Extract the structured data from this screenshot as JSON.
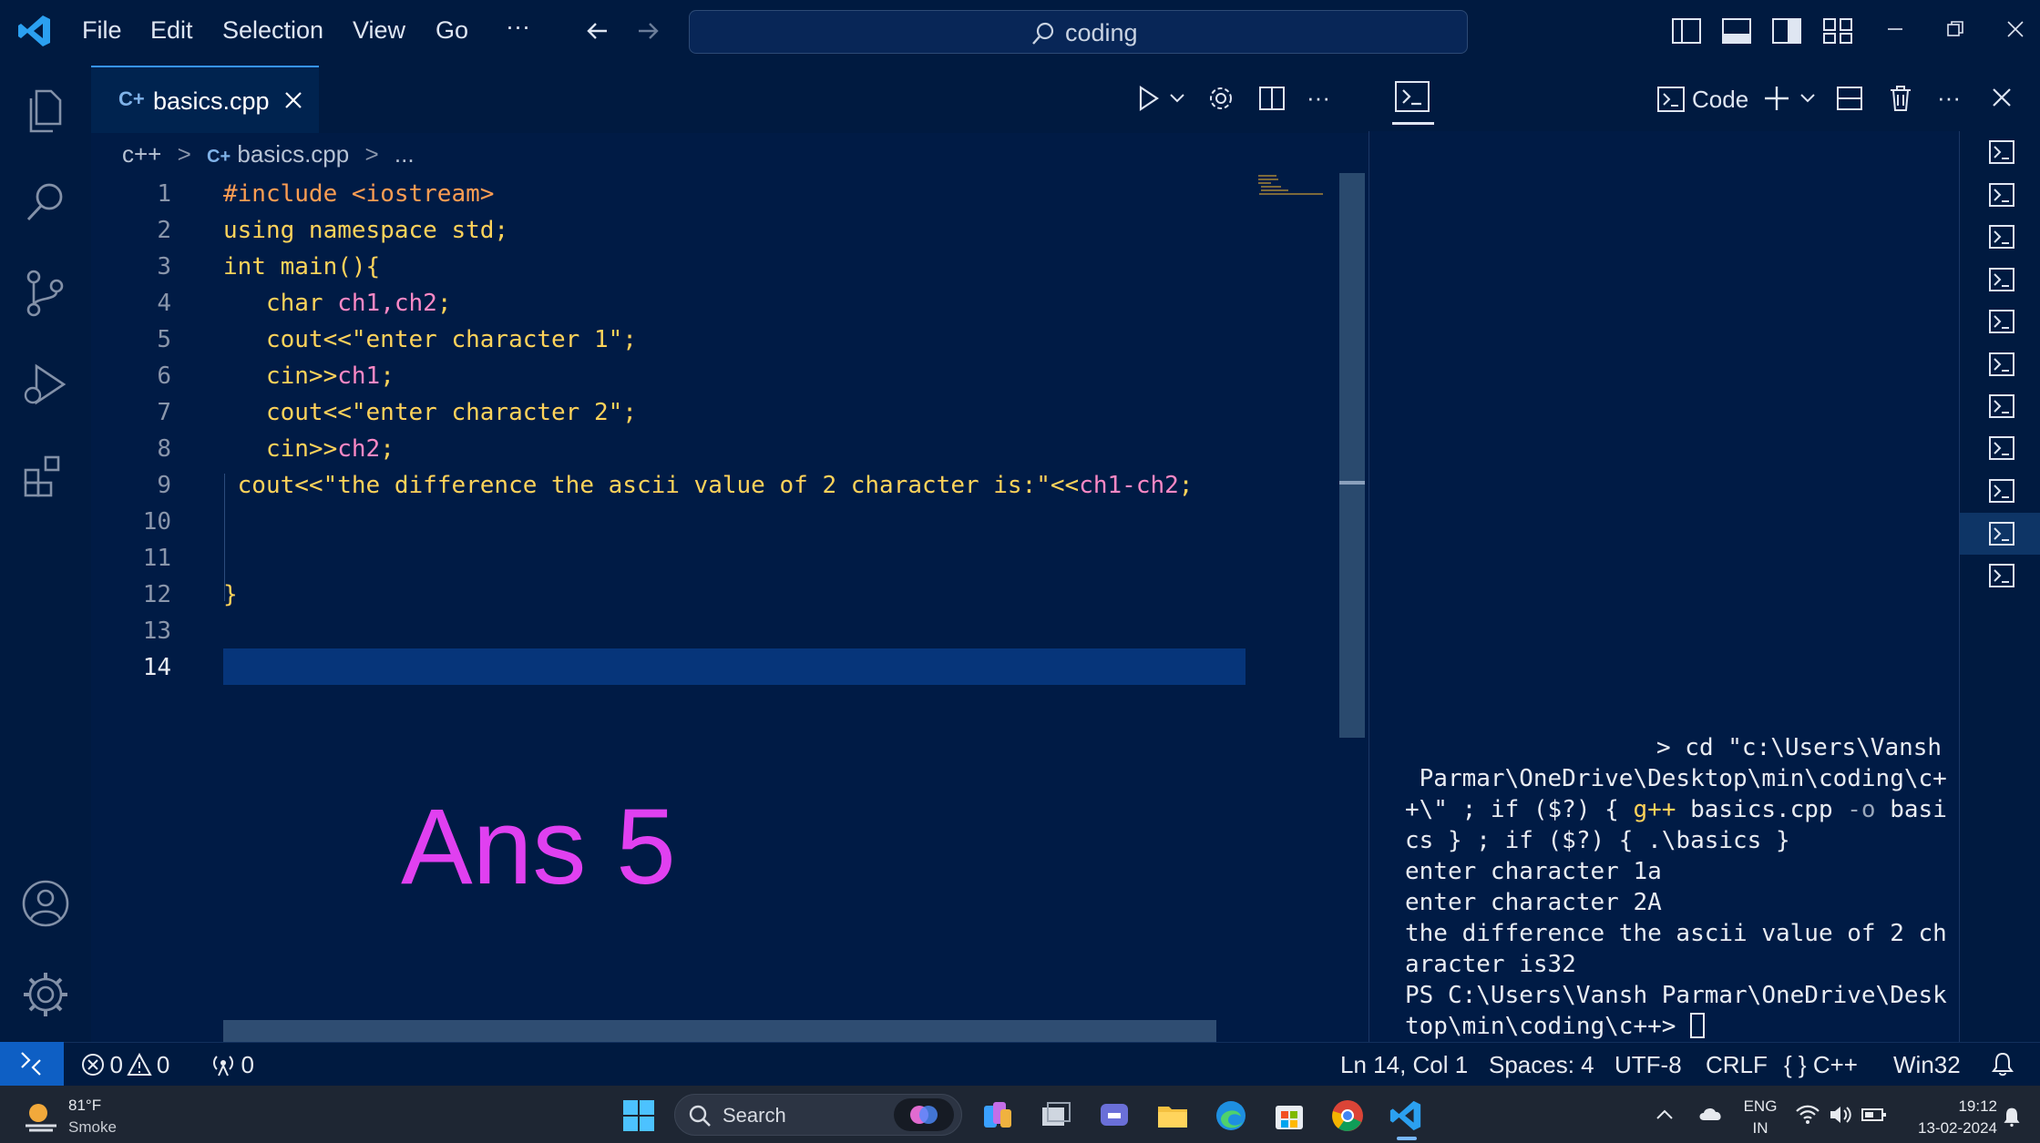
{
  "menu": {
    "file": "File",
    "edit": "Edit",
    "selection": "Selection",
    "view": "View",
    "go": "Go",
    "more": "···"
  },
  "search": {
    "text": "coding"
  },
  "editor": {
    "tab_label": "basics.cpp",
    "breadcrumb": {
      "folder": "c++",
      "file": "basics.cpp",
      "ellipsis": "..."
    },
    "line_numbers": [
      "1",
      "2",
      "3",
      "4",
      "5",
      "6",
      "7",
      "8",
      "9",
      "10",
      "11",
      "12",
      "13",
      "14"
    ],
    "code": {
      "l1_a": "#include",
      "l1_b": " <iostream>",
      "l2_a": "using namespace",
      "l2_b": " std;",
      "l3_a": "int",
      "l3_b": " main(){",
      "l4_a": "   char",
      "l4_b": " ch1,",
      "l4_c": "ch2",
      "l4_d": ";",
      "l5": "   cout<<\"enter character 1\";",
      "l6_a": "   cin>>",
      "l6_b": "ch1",
      "l6_c": ";",
      "l7": "   cout<<\"enter character 2\";",
      "l8_a": "   cin>>",
      "l8_b": "ch2",
      "l8_c": ";",
      "l9_a": " cout<<\"the difference the ascii value of 2 character is:\"<<",
      "l9_b": "ch1-ch2",
      "l9_c": ";",
      "l12": "}"
    },
    "overlay_text": "Ans 5"
  },
  "panel": {
    "code_label": "Code",
    "terminal_lines": [
      "> cd \"c:\\Users\\Vansh",
      " Parmar\\OneDrive\\Desktop\\min\\coding\\c+",
      "+\\\" ; if ($?) { g++ basics.cpp -o basi",
      "cs } ; if ($?) { .\\basics }",
      "enter character 1a",
      "enter character 2A",
      "the difference the ascii value of 2 ch",
      "aracter is32",
      "PS C:\\Users\\Vansh Parmar\\OneDrive\\Desk",
      "top\\min\\coding\\c++> "
    ],
    "t3_a": "+\\\" ; if ($?) { ",
    "t3_b": "g++",
    "t3_c": " basics.cpp ",
    "t3_d": "-o",
    "t3_e": " basi"
  },
  "status": {
    "errors": "0",
    "warnings": "0",
    "ports": "0",
    "position": "Ln 14, Col 1",
    "spaces": "Spaces: 4",
    "encoding": "UTF-8",
    "eol": "CRLF",
    "language": "{ } C++",
    "platform": "Win32"
  },
  "taskbar": {
    "weather_temp": "81°F",
    "weather_desc": "Smoke",
    "search_label": "Search",
    "lang_1": "ENG",
    "lang_2": "IN",
    "time": "19:12",
    "date": "13-02-2024"
  },
  "colors": {
    "accent": "#3794ff",
    "editor_bg": "#001b45",
    "overlay": "#e040f0",
    "keyword": "#ffd35a"
  }
}
